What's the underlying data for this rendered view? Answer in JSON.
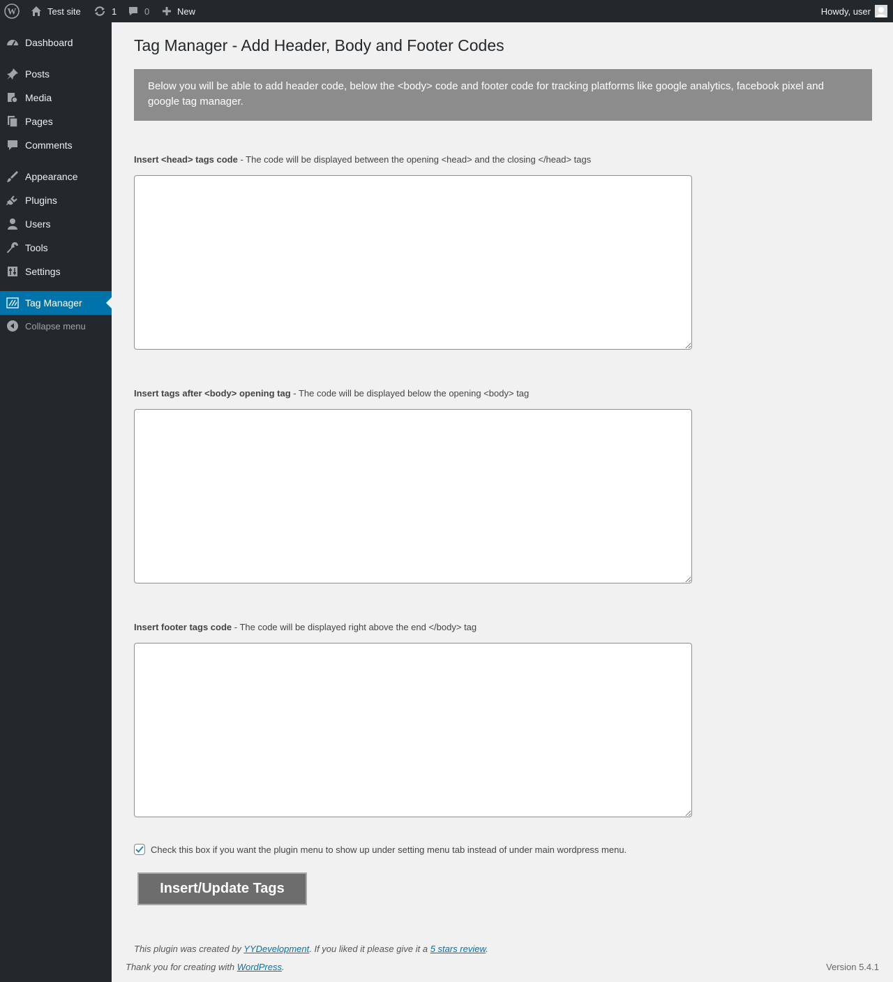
{
  "adminbar": {
    "site_name": "Test site",
    "updates_count": "1",
    "comments_count": "0",
    "new_label": "New",
    "greeting": "Howdy, user"
  },
  "sidebar": {
    "items": [
      {
        "label": "Dashboard",
        "icon": "dashboard-icon"
      },
      {
        "label": "Posts",
        "icon": "pin-icon"
      },
      {
        "label": "Media",
        "icon": "media-icon"
      },
      {
        "label": "Pages",
        "icon": "pages-icon"
      },
      {
        "label": "Comments",
        "icon": "comment-icon"
      },
      {
        "label": "Appearance",
        "icon": "brush-icon"
      },
      {
        "label": "Plugins",
        "icon": "plug-icon"
      },
      {
        "label": "Users",
        "icon": "user-icon"
      },
      {
        "label": "Tools",
        "icon": "wrench-icon"
      },
      {
        "label": "Settings",
        "icon": "sliders-icon"
      },
      {
        "label": "Tag Manager",
        "icon": "tag-manager-icon"
      }
    ],
    "collapse_label": "Collapse menu"
  },
  "main": {
    "title": "Tag Manager - Add Header, Body and Footer Codes",
    "notice": "Below you will be able to add header code, below the <body> code and footer code for tracking platforms like google analytics, facebook pixel and google tag manager.",
    "fields": [
      {
        "label_bold": "Insert <head> tags code",
        "label_rest": " - The code will be displayed between the opening <head> and the closing </head> tags",
        "value": ""
      },
      {
        "label_bold": "Insert tags after <body> opening tag",
        "label_rest": " - The code will be displayed below the opening <body> tag",
        "value": ""
      },
      {
        "label_bold": "Insert footer tags code",
        "label_rest": " - The code will be displayed right above the end </body> tag",
        "value": ""
      }
    ],
    "checkbox_label": "Check this box if you want the plugin menu to show up under setting menu tab instead of under main wordpress menu.",
    "checkbox_checked": true,
    "submit_label": "Insert/Update Tags",
    "credit_prefix": "This plugin was created by ",
    "credit_link": "YYDevelopment",
    "credit_middle": ". If you liked it please give it a ",
    "credit_review_link": "5 stars review",
    "credit_suffix": "."
  },
  "footer": {
    "thanks_prefix": "Thank you for creating with ",
    "thanks_link": "WordPress",
    "thanks_suffix": ".",
    "version": "Version 5.4.1"
  },
  "colors": {
    "accent": "#0073aa",
    "adminbar_bg": "#23282d",
    "notice_bg": "#8c8c8c",
    "button_bg": "#6d6d6d"
  }
}
